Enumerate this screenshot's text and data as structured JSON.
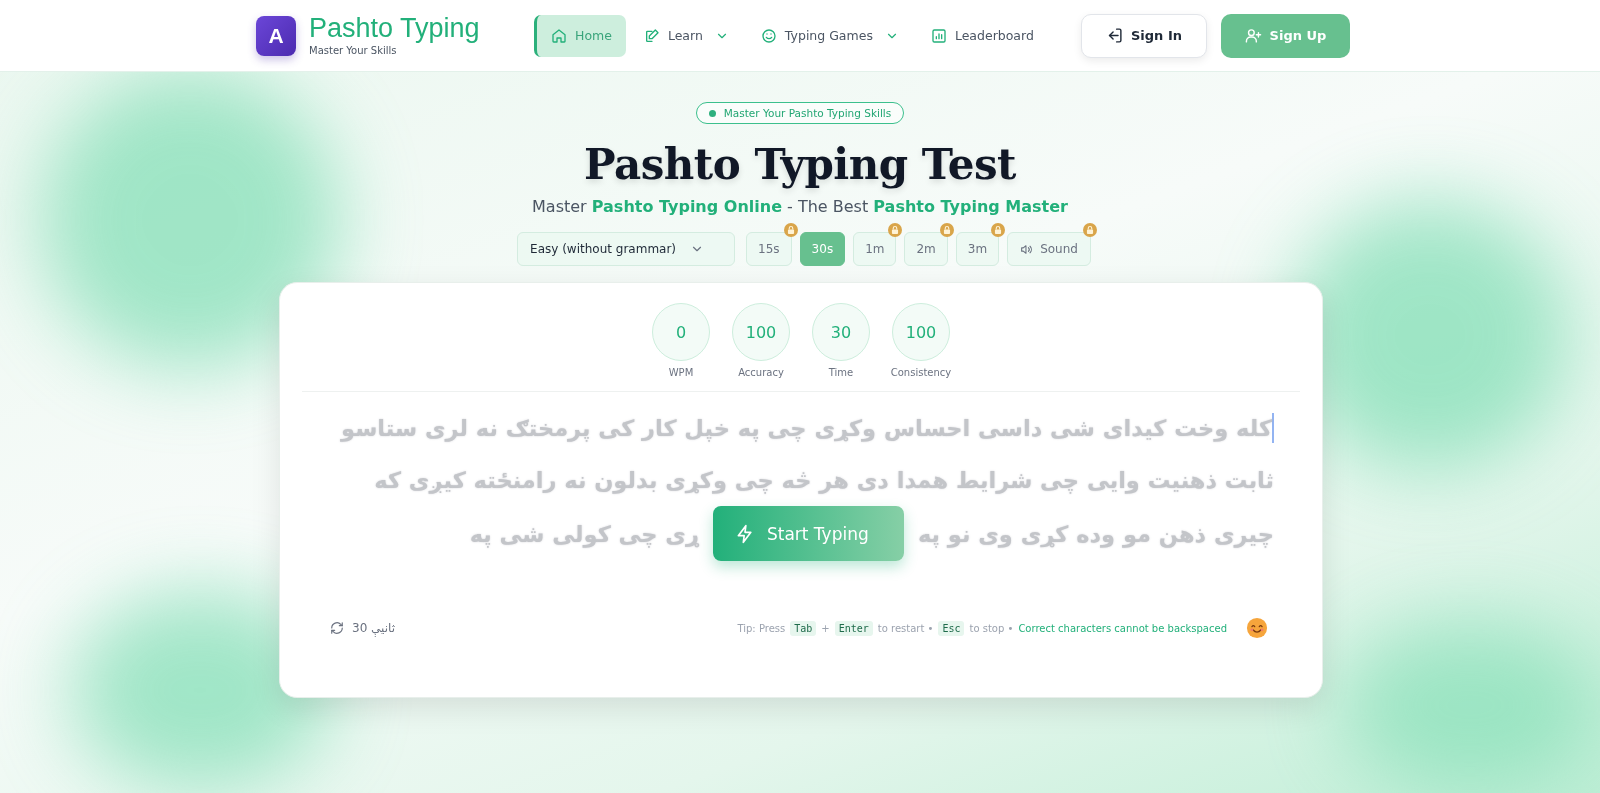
{
  "header": {
    "logo_letter": "A",
    "brand": "Pashto Typing",
    "tagline": "Master Your Skills",
    "nav": [
      {
        "label": "Home",
        "dropdown": false,
        "selected": true
      },
      {
        "label": "Learn",
        "dropdown": true,
        "selected": false
      },
      {
        "label": "Typing Games",
        "dropdown": true,
        "selected": false
      },
      {
        "label": "Leaderboard",
        "dropdown": false,
        "selected": false
      }
    ],
    "buttons": [
      {
        "label": "Sign In",
        "kind": "outline"
      },
      {
        "label": "Sign Up",
        "kind": "primary"
      }
    ]
  },
  "hero": {
    "badge": "Master Your Pashto Typing Skills",
    "title": "Pashto Typing Test",
    "subtitle": "Master **Pashto Typing Online** - The Best **Pashto Typing Master**"
  },
  "options": {
    "difficulty": "Easy (without grammar)",
    "durations": [
      {
        "label": "15s",
        "selected": false,
        "locked": true
      },
      {
        "label": "30s",
        "selected": true,
        "locked": false
      },
      {
        "label": "1m",
        "selected": false,
        "locked": true
      },
      {
        "label": "2m",
        "selected": false,
        "locked": true
      },
      {
        "label": "3m",
        "selected": false,
        "locked": true
      }
    ],
    "sound": {
      "label": "Sound",
      "locked": true
    }
  },
  "stats": [
    {
      "value": "0",
      "label": "WPM"
    },
    {
      "value": "100",
      "label": "Accuracy"
    },
    {
      "value": "30",
      "label": "Time"
    },
    {
      "value": "100",
      "label": "Consistency"
    }
  ],
  "text_lines": [
    [
      "کله وخت کیدای شی داسی احساس وکړی چی په خپل کار کی پرمختګ نه لری ستاسو"
    ],
    [
      "ثابت ذهنیت وایی چی شرایط همدا دی هر څه چی وکړی بدلون نه رامنځته کیږی که"
    ],
    [
      "چیری ذهن مو وده کړی وی نو په",
      "ړی چی کولی شی په"
    ]
  ],
  "start_button": "Start Typing",
  "footer": {
    "timer": "ثانیې 30",
    "tip": [
      {
        "kind": "text",
        "text": "Tip: Press"
      },
      {
        "kind": "key",
        "text": "Tab"
      },
      {
        "kind": "text",
        "text": "+"
      },
      {
        "kind": "key",
        "text": "Enter"
      },
      {
        "kind": "text",
        "text": "to restart •"
      },
      {
        "kind": "key",
        "text": "Esc"
      },
      {
        "kind": "text",
        "text": "to stop •"
      },
      {
        "kind": "note",
        "text": "Correct characters cannot be backspaced"
      }
    ]
  }
}
